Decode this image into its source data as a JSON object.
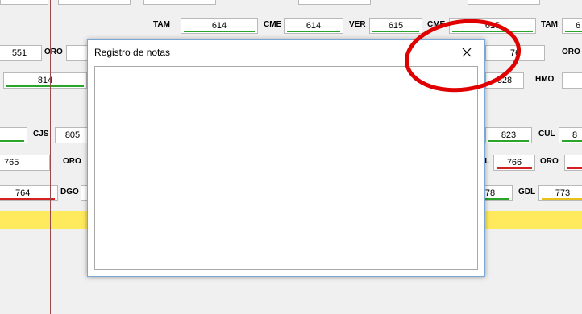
{
  "dialog": {
    "title": "Registro de notas"
  },
  "annotation": {
    "shape": "ellipse",
    "color": "#e00000"
  },
  "colors": {
    "green": "#2aa52a",
    "red": "#d42020",
    "yellow": "#e8c21a",
    "highlight": "#ffe95c"
  },
  "rows": {
    "r1": {
      "codes": [
        "TAM",
        "CME",
        "VER",
        "CME",
        "TAM"
      ],
      "values": [
        "614",
        "614",
        "615",
        "615",
        "6"
      ]
    },
    "r2": {
      "codes": [
        "ORO",
        "ORO"
      ],
      "values": [
        "551",
        "76"
      ]
    },
    "r3": {
      "codes": [
        "HMO"
      ],
      "values": [
        "814",
        "828"
      ]
    },
    "r4": {
      "codes": [
        "CJS",
        "CUL"
      ],
      "values": [
        "805",
        "823",
        "8"
      ]
    },
    "r5": {
      "codes": [
        "ORO",
        "DL",
        "ORO"
      ],
      "values": [
        "765",
        "766"
      ]
    },
    "r6": {
      "codes": [
        "DGO",
        "GDL"
      ],
      "values": [
        "764",
        "78",
        "773"
      ]
    }
  }
}
